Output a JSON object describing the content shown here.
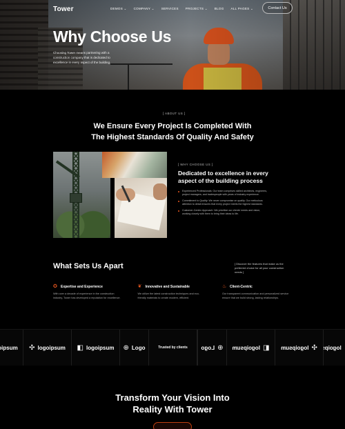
{
  "nav": {
    "logo": "Tower",
    "menu": [
      "DEMOS ⌄",
      "COMPANY ⌄",
      "SERVICES",
      "PROJECTS ⌄",
      "BLOG",
      "ALL PAGES ⌄"
    ],
    "contact_label": "Contact Us"
  },
  "hero": {
    "title": "Why Choose Us",
    "description": "Choosing Tower means partnering with a construction company that is dedicated to excellence in every aspect of the building."
  },
  "about": {
    "tag": "[ ABOUT US ]",
    "title_line1": "We Ensure Every Project Is Completed With",
    "title_line2": "The Highest Standards Of Quality And Safety"
  },
  "why": {
    "tag": "[ WHY CHOOSE US ]",
    "title": "Dedicated to excellence in every aspect of the building process",
    "points": [
      "Experienced Professionals: Our team comprises skilled architects, engineers, project managers, and tradespeople with years of industry experience.",
      "Commitment to Quality: We never compromise on quality. Our meticulous attention to detail ensures that every project meets the highest standards.",
      "Customer-Centric Approach: We prioritize our clients' needs and vision, working closely with them to bring their ideas to life."
    ]
  },
  "apart": {
    "title": "What Sets Us Apart",
    "description": "[ Discover the features that make us the preferred choice for all your construction needs ]",
    "features": [
      {
        "icon": "medal-icon",
        "title": "Expertise and Experience",
        "desc": "With over a decade of experience in the construction industry, Tower has developed a reputation for excellence."
      },
      {
        "icon": "leaf-icon",
        "title": "Innovative and Sustainable",
        "desc": "We utilize the latest construction techniques and eco-friendly materials to create modern, efficient."
      },
      {
        "icon": "handshake-icon",
        "title": "Client-Centric",
        "desc": "Our transparent communication and personalized service ensure that we build strong, lasting relationships."
      }
    ]
  },
  "logos": {
    "brand": "logoipsum",
    "brand_short": "Logo",
    "trusted": "Trusted by clients"
  },
  "cta": {
    "title_line1": "Transform Your Vision Into",
    "title_line2": "Reality With Tower"
  },
  "colors": {
    "accent": "#e8571f",
    "background": "#000000"
  }
}
